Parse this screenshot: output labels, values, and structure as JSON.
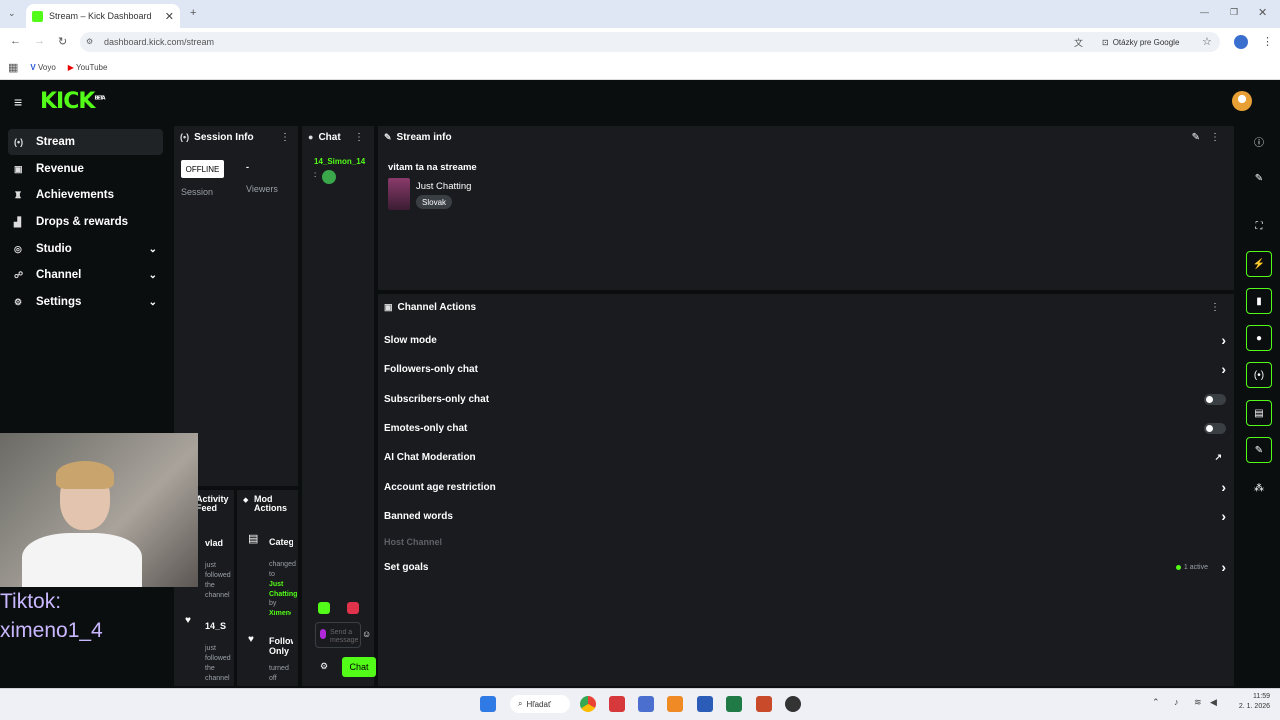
{
  "browser": {
    "tab_title": "Stream – Kick Dashboard",
    "url": "dashboard.kick.com/stream",
    "translate_chip": "Otázky pre Google",
    "bookmarks": [
      {
        "label": "Voyo"
      },
      {
        "label": "YouTube"
      }
    ]
  },
  "app": {
    "logo": "KICK",
    "logo_badge": "BETA"
  },
  "sidebar": {
    "items": [
      {
        "label": "Stream",
        "icon": "broadcast-icon",
        "active": true
      },
      {
        "label": "Revenue",
        "icon": "wallet-icon"
      },
      {
        "label": "Achievements",
        "icon": "trophy-icon"
      },
      {
        "label": "Drops & rewards",
        "icon": "chart-icon"
      },
      {
        "label": "Studio",
        "icon": "camera-icon",
        "expandable": true
      },
      {
        "label": "Channel",
        "icon": "users-icon",
        "expandable": true
      },
      {
        "label": "Settings",
        "icon": "gear-icon",
        "expandable": true
      }
    ]
  },
  "session_info": {
    "title": "Session Info",
    "status": "OFFLINE",
    "session_label": "Session",
    "viewers_value": "-",
    "viewers_label": "Viewers"
  },
  "chat": {
    "title": "Chat",
    "username": "14_Simon_14",
    "placeholder": "Send a message",
    "chat_button": "Chat"
  },
  "activity_feed": {
    "title": "Activity Feed",
    "item1_user": "vlad",
    "item1_text": "just followed the channel",
    "item2_user": "14_S",
    "item2_text": "just followed the channel"
  },
  "mod_actions": {
    "title": "Mod Actions",
    "item1_title": "Category",
    "item1_text": "changed to",
    "item1_value": "Just Chatting",
    "item1_by": "by",
    "item1_user": "Ximeno",
    "item2_title": "Followers Only",
    "item2_text": "turned off"
  },
  "stream_info": {
    "title": "Stream info",
    "stream_title": "vitam ta na streame",
    "category": "Just Chatting",
    "language": "Slovak"
  },
  "channel_actions": {
    "title": "Channel Actions",
    "rows": [
      {
        "label": "Slow mode",
        "control": "chevron"
      },
      {
        "label": "Followers-only chat",
        "control": "chevron"
      },
      {
        "label": "Subscribers-only chat",
        "control": "toggle"
      },
      {
        "label": "Emotes-only chat",
        "control": "toggle"
      },
      {
        "label": "AI Chat Moderation",
        "control": "external"
      },
      {
        "label": "Account age restriction",
        "control": "chevron"
      },
      {
        "label": "Banned words",
        "control": "chevron"
      },
      {
        "label": "Host Channel",
        "control": "disabled"
      },
      {
        "label": "Set goals",
        "control": "chevron",
        "badge": "1 active"
      }
    ]
  },
  "overlay": {
    "tiktok_line1": "Tiktok:",
    "tiktok_line2": "ximeno1_4"
  },
  "taskbar": {
    "search": "Hľadať",
    "time": "11:59",
    "date": "2. 1. 2026"
  },
  "colors": {
    "brand": "#53fc18",
    "panel": "#191b1f",
    "background": "#0b0e0f"
  }
}
